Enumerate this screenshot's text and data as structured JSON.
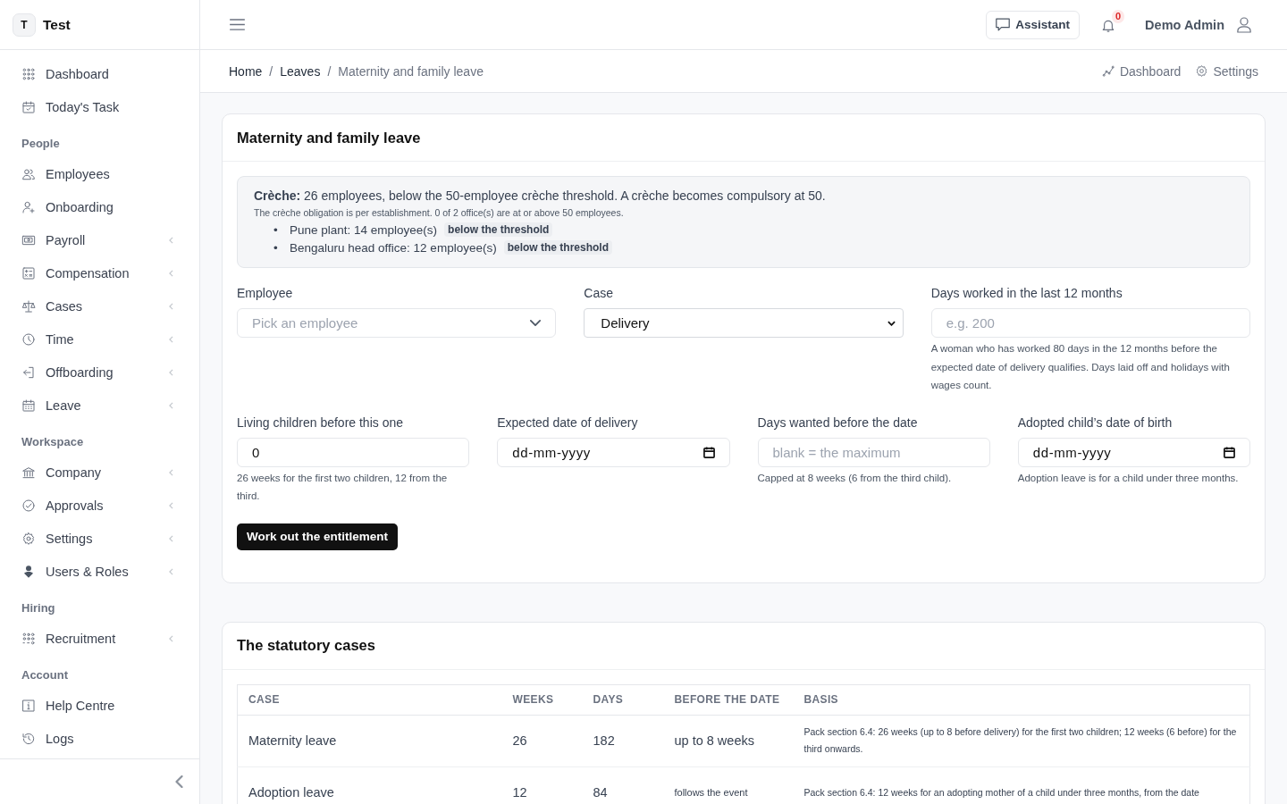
{
  "brand": {
    "initial": "T",
    "name": "Test"
  },
  "sidebar": {
    "sections": [
      {
        "items": [
          {
            "label": "Dashboard",
            "expandable": false
          },
          {
            "label": "Today's Task",
            "expandable": false
          }
        ]
      },
      {
        "heading": "People",
        "items": [
          {
            "label": "Employees",
            "expandable": false
          },
          {
            "label": "Onboarding",
            "expandable": false
          },
          {
            "label": "Payroll",
            "expandable": true
          },
          {
            "label": "Compensation",
            "expandable": true
          },
          {
            "label": "Cases",
            "expandable": true
          },
          {
            "label": "Time",
            "expandable": true
          },
          {
            "label": "Offboarding",
            "expandable": true
          },
          {
            "label": "Leave",
            "expandable": true
          }
        ]
      },
      {
        "heading": "Workspace",
        "items": [
          {
            "label": "Company",
            "expandable": true
          },
          {
            "label": "Approvals",
            "expandable": true
          },
          {
            "label": "Settings",
            "expandable": true
          },
          {
            "label": "Users & Roles",
            "expandable": true
          }
        ]
      },
      {
        "heading": "Hiring",
        "items": [
          {
            "label": "Recruitment",
            "expandable": true
          }
        ]
      },
      {
        "heading": "Account",
        "items": [
          {
            "label": "Help Centre",
            "expandable": false
          },
          {
            "label": "Logs",
            "expandable": false
          }
        ]
      }
    ]
  },
  "header": {
    "assistant": "Assistant",
    "notification_count": "0",
    "user_name": "Demo Admin"
  },
  "breadcrumb": {
    "separator": "/",
    "items": [
      "Home",
      "Leaves",
      "Maternity and family leave"
    ],
    "actions": [
      "Dashboard",
      "Settings"
    ]
  },
  "entitlement_card": {
    "title": "Maternity and family leave",
    "notice": {
      "summary": "**Crèche:** 26 employees, below the 50-employee crèche threshold. A crèche becomes compulsory at 50.",
      "note": "The crèche obligation is per establishment. 0 of 2 office(s) are at or above 50 employees.",
      "bullet": "•",
      "establishments": [
        {
          "text": "Pune plant: 14 employee(s)",
          "status": "below the threshold"
        },
        {
          "text": "Bengaluru head office: 12 employee(s)",
          "status": "below the threshold"
        }
      ]
    },
    "field_rows": [
      [
        {
          "kind": "combobox",
          "label": "Employee",
          "placeholder": "Pick an employee"
        },
        {
          "kind": "select",
          "label": "Case",
          "value": "Delivery"
        },
        {
          "kind": "text",
          "label": "Days worked in the last 12 months",
          "placeholder": "e.g. 200",
          "help": "A woman who has worked 80 days in the 12 months before the expected date of delivery qualifies. Days laid off and holidays with wages count."
        }
      ],
      [
        {
          "kind": "text",
          "label": "Living children before this one",
          "value": "0",
          "help": "26 weeks for the first two children, 12 from the third."
        },
        {
          "kind": "date",
          "label": "Expected date of delivery",
          "placeholder": "dd-mm-yyyy"
        },
        {
          "kind": "text",
          "label": "Days wanted before the date",
          "placeholder": "blank = the maximum",
          "help": "Capped at 8 weeks (6 from the third child)."
        },
        {
          "kind": "date",
          "label": "Adopted child’s date of birth",
          "placeholder": "dd-mm-yyyy",
          "help": "Adoption leave is for a child under three months."
        }
      ]
    ],
    "button": "Work out the entitlement"
  },
  "cases_card": {
    "title": "The statutory cases",
    "columns": [
      "CASE",
      "WEEKS",
      "DAYS",
      "BEFORE THE DATE",
      "BASIS"
    ],
    "rows": [
      {
        "kind": "period",
        "case": "Maternity leave",
        "weeks": "26",
        "days": "182",
        "before": "up to 8 weeks",
        "basis": "Pack section 6.4: 26 weeks (up to 8 before delivery) for the first two children; 12 weeks (6 before) for the third onwards."
      },
      {
        "kind": "note",
        "case": "Adoption leave",
        "weeks": "12",
        "days": "84",
        "before": "follows the event",
        "basis": "Pack section 6.4: 12 weeks for an adopting mother of a child under three months, from the date"
      }
    ]
  }
}
